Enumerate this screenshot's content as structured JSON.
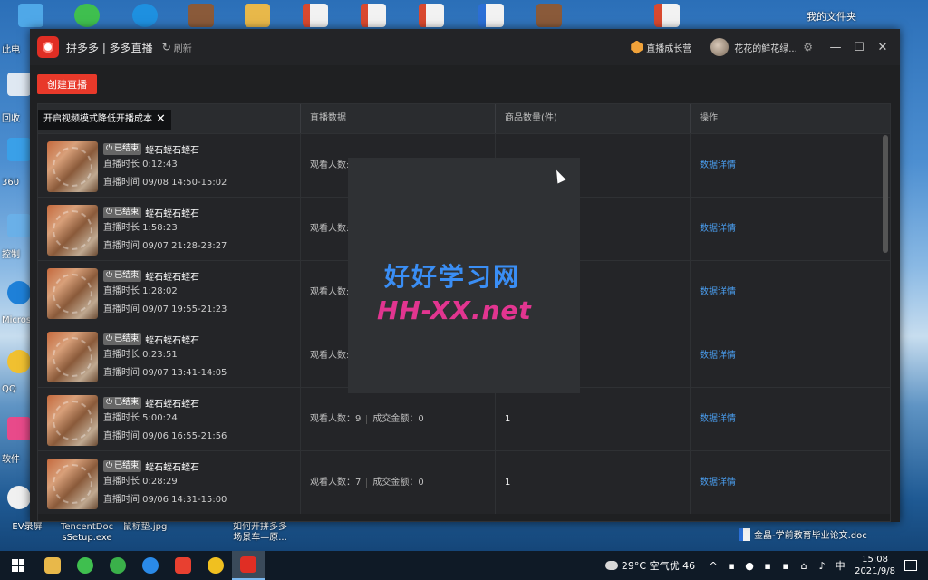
{
  "desktop": {
    "top_right_label": "我的文件夹",
    "left_labels": [
      "此电",
      "回收",
      "360",
      "控制",
      "Micros",
      "QQ",
      "软件",
      "EV录屏"
    ],
    "bottom_labels": [
      "EV录屏",
      "TencentDoc\nsSetup.exe",
      "鼠标垫.jpg",
      "如何开拼多多\n场景车—原..."
    ],
    "bottom_doc": "金晶-学前教育毕业论文.doc"
  },
  "window": {
    "title": "拼多多 | 多多直播",
    "refresh_label": "刷新",
    "growth_label": "直播成长营",
    "user_name": "花花的鲜花绿...",
    "create_button": "创建直播",
    "tooltip": "开启视频模式降低开播成本",
    "columns": [
      "",
      "直播数据",
      "商品数量(件)",
      "操作"
    ],
    "rows": [
      {
        "status": "已结束",
        "title": "蛭石蛭石蛭石",
        "duration": "直播时长 0:12:43",
        "time": "直播时间 09/08 14:50-15:02",
        "viewers": "观看人数:",
        "amount": "",
        "qty": "",
        "action": "数据详情"
      },
      {
        "status": "已结束",
        "title": "蛭石蛭石蛭石",
        "duration": "直播时长 1:58:23",
        "time": "直播时间 09/07 21:28-23:27",
        "viewers": "观看人数:",
        "amount": "",
        "qty": "",
        "action": "数据详情"
      },
      {
        "status": "已结束",
        "title": "蛭石蛭石蛭石",
        "duration": "直播时长 1:28:02",
        "time": "直播时间 09/07 19:55-21:23",
        "viewers": "观看人数:",
        "amount": "",
        "qty": "",
        "action": "数据详情"
      },
      {
        "status": "已结束",
        "title": "蛭石蛭石蛭石",
        "duration": "直播时长 0:23:51",
        "time": "直播时间 09/07 13:41-14:05",
        "viewers": "观看人数:",
        "amount": "",
        "qty": "",
        "action": "数据详情"
      },
      {
        "status": "已结束",
        "title": "蛭石蛭石蛭石",
        "duration": "直播时长 5:00:24",
        "time": "直播时间 09/06 16:55-21:56",
        "viewers": "观看人数：9",
        "amount": "成交金额：0",
        "qty": "1",
        "action": "数据详情"
      },
      {
        "status": "已结束",
        "title": "蛭石蛭石蛭石",
        "duration": "直播时长 0:28:29",
        "time": "直播时间 09/06 14:31-15:00",
        "viewers": "观看人数：7",
        "amount": "成交金额：0",
        "qty": "1",
        "action": "数据详情"
      }
    ]
  },
  "watermark": {
    "line1": "好好学习网",
    "line2": "HH-XX.net"
  },
  "taskbar": {
    "weather": "29°C 空气优 46",
    "ime": "中",
    "time": "15:08",
    "date": "2021/9/8"
  }
}
